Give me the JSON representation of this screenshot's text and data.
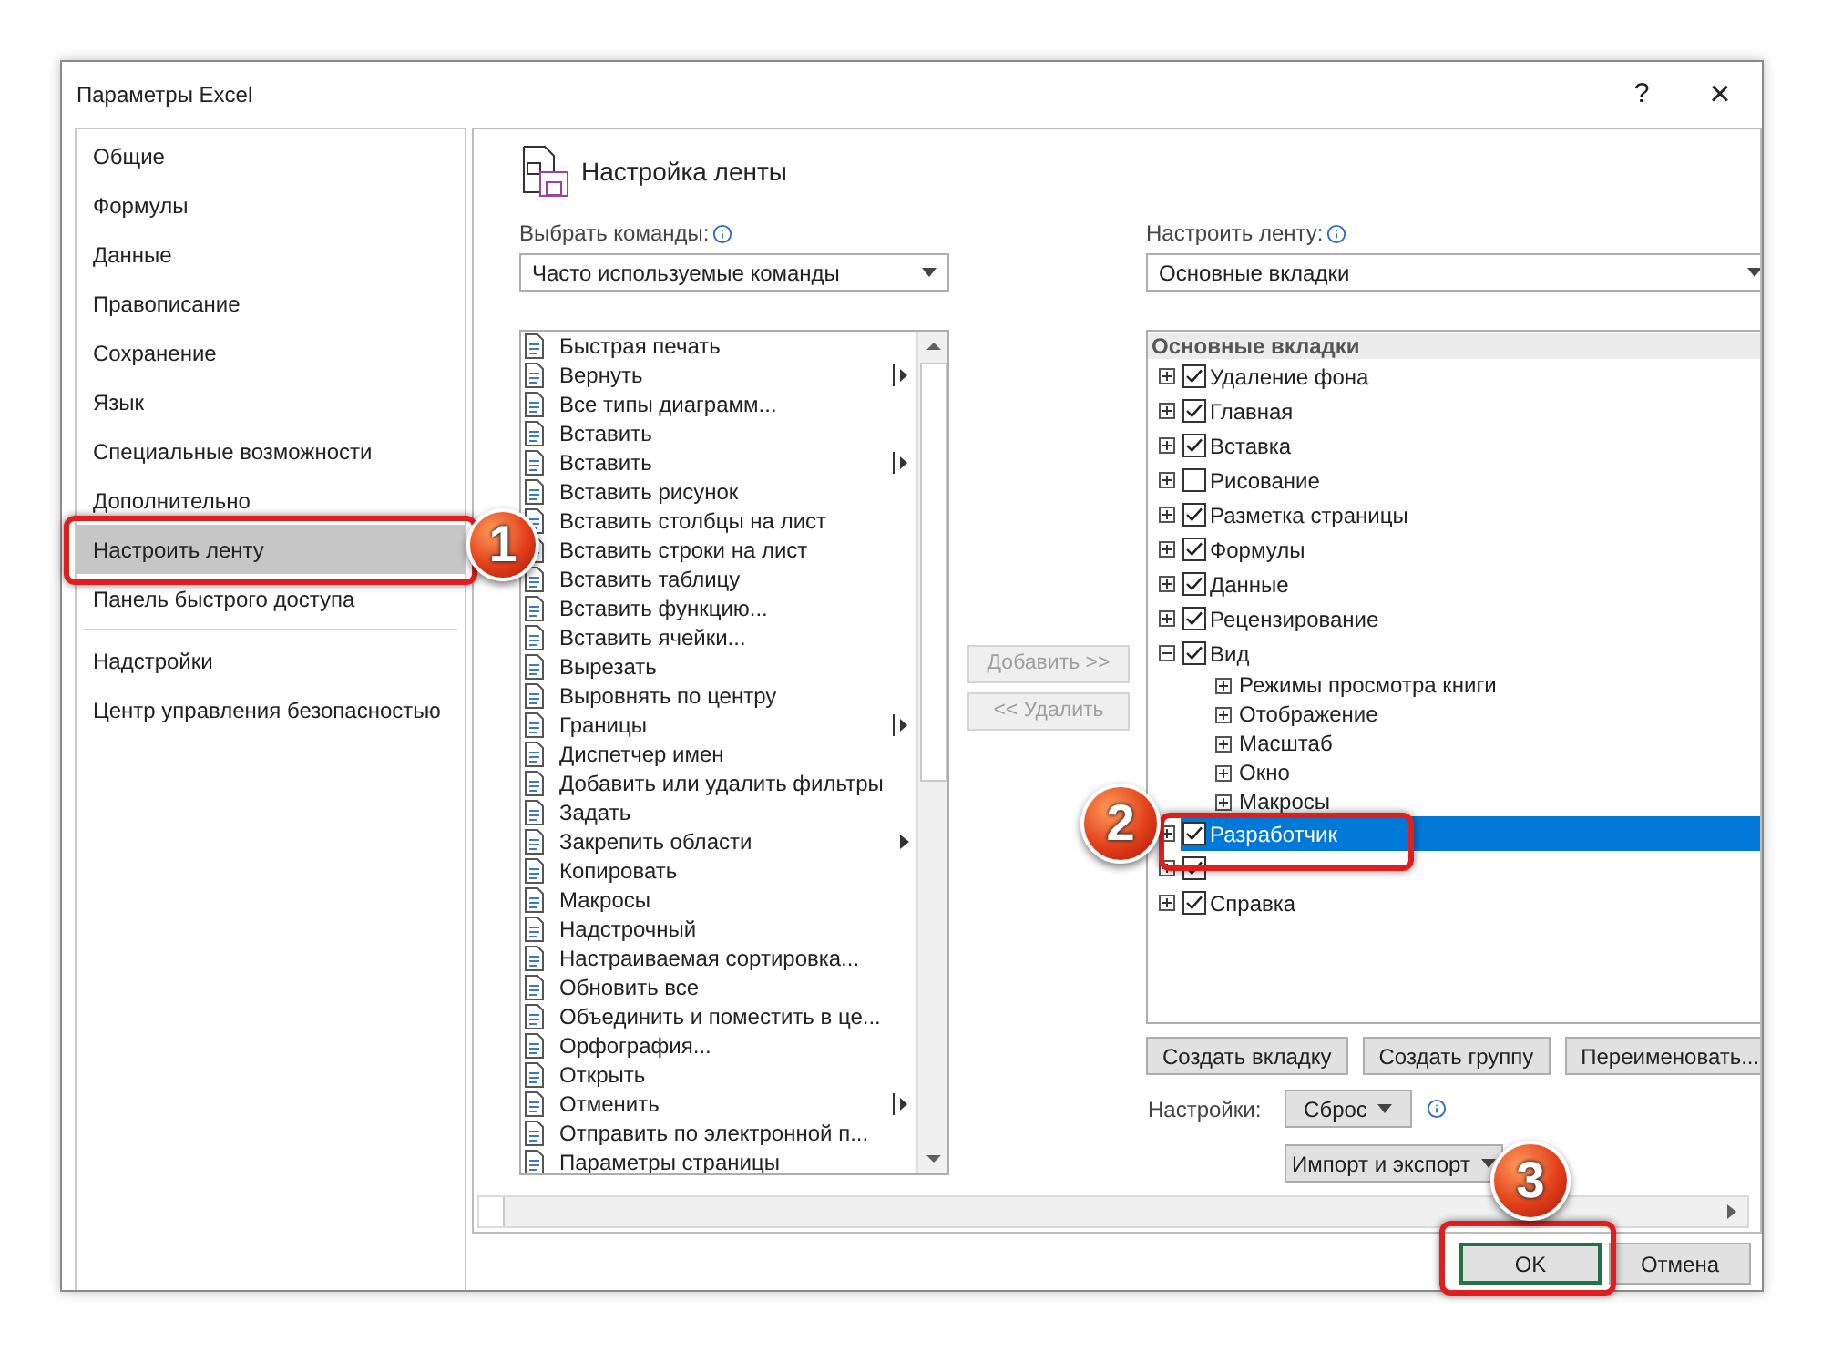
{
  "window": {
    "title": "Параметры Excel",
    "help": "?",
    "close": "×"
  },
  "sidebar": {
    "groups": [
      [
        {
          "label": "Общие",
          "selected": false
        },
        {
          "label": "Формулы",
          "selected": false
        },
        {
          "label": "Данные",
          "selected": false
        },
        {
          "label": "Правописание",
          "selected": false
        },
        {
          "label": "Сохранение",
          "selected": false
        },
        {
          "label": "Язык",
          "selected": false
        },
        {
          "label": "Специальные возможности",
          "selected": false
        },
        {
          "label": "Дополнительно",
          "selected": false
        },
        {
          "label": "Настроить ленту",
          "selected": true
        },
        {
          "label": "Панель быстрого доступа",
          "selected": false
        }
      ],
      [
        {
          "label": "Надстройки",
          "selected": false
        },
        {
          "label": "Центр управления безопасностью",
          "selected": false
        }
      ]
    ]
  },
  "main": {
    "heading": "Настройка ленты",
    "commands": {
      "label": "Выбрать команды:",
      "dropdown": "Часто используемые команды",
      "items": [
        {
          "label": "Быстрая печать",
          "kind": "plain"
        },
        {
          "label": "Вернуть",
          "kind": "split"
        },
        {
          "label": "Все типы диаграмм...",
          "kind": "plain"
        },
        {
          "label": "Вставить",
          "kind": "plain"
        },
        {
          "label": "Вставить",
          "kind": "split"
        },
        {
          "label": "Вставить рисунок",
          "kind": "plain"
        },
        {
          "label": "Вставить столбцы на лист",
          "kind": "plain"
        },
        {
          "label": "Вставить строки на лист",
          "kind": "plain"
        },
        {
          "label": "Вставить таблицу",
          "kind": "plain"
        },
        {
          "label": "Вставить функцию...",
          "kind": "plain"
        },
        {
          "label": "Вставить ячейки...",
          "kind": "plain"
        },
        {
          "label": "Вырезать",
          "kind": "plain"
        },
        {
          "label": "Выровнять по центру",
          "kind": "plain"
        },
        {
          "label": "Границы",
          "kind": "split"
        },
        {
          "label": "Диспетчер имен",
          "kind": "plain"
        },
        {
          "label": "Добавить или удалить фильтры",
          "kind": "plain"
        },
        {
          "label": "Задать",
          "kind": "plain"
        },
        {
          "label": "Закрепить области",
          "kind": "submenu"
        },
        {
          "label": "Копировать",
          "kind": "plain"
        },
        {
          "label": "Макросы",
          "kind": "plain"
        },
        {
          "label": "Надстрочный",
          "kind": "plain"
        },
        {
          "label": "Настраиваемая сортировка...",
          "kind": "plain"
        },
        {
          "label": "Обновить все",
          "kind": "plain"
        },
        {
          "label": "Объединить и поместить в це...",
          "kind": "plain"
        },
        {
          "label": "Орфография...",
          "kind": "plain"
        },
        {
          "label": "Открыть",
          "kind": "plain"
        },
        {
          "label": "Отменить",
          "kind": "split"
        },
        {
          "label": "Отправить по электронной п...",
          "kind": "plain"
        },
        {
          "label": "Параметры страницы",
          "kind": "plain"
        }
      ]
    },
    "transfer_buttons": [
      {
        "label": "Добавить >>",
        "disabled": true
      },
      {
        "label": "<< Удалить",
        "disabled": true
      }
    ],
    "ribbon": {
      "label": "Настроить ленту:",
      "dropdown": "Основные вкладки",
      "header": "Основные вкладки",
      "tabs": [
        {
          "label": "Удаление фона",
          "checked": true,
          "expanded": false,
          "selected": false
        },
        {
          "label": "Главная",
          "checked": true,
          "expanded": false,
          "selected": false
        },
        {
          "label": "Вставка",
          "checked": true,
          "expanded": false,
          "selected": false
        },
        {
          "label": "Рисование",
          "checked": false,
          "expanded": false,
          "selected": false
        },
        {
          "label": "Разметка страницы",
          "checked": true,
          "expanded": false,
          "selected": false
        },
        {
          "label": "Формулы",
          "checked": true,
          "expanded": false,
          "selected": false
        },
        {
          "label": "Данные",
          "checked": true,
          "expanded": false,
          "selected": false
        },
        {
          "label": "Рецензирование",
          "checked": true,
          "expanded": false,
          "selected": false
        },
        {
          "label": "Вид",
          "checked": true,
          "expanded": true,
          "selected": false,
          "children": [
            {
              "label": "Режимы просмотра книги",
              "expanded": false
            },
            {
              "label": "Отображение",
              "expanded": false
            },
            {
              "label": "Масштаб",
              "expanded": false
            },
            {
              "label": "Окно",
              "expanded": false
            },
            {
              "label": "Макросы",
              "expanded": false
            }
          ]
        },
        {
          "label": "Разработчик",
          "checked": true,
          "expanded": false,
          "selected": true
        },
        {
          "checked": true,
          "expanded": false,
          "selected": false
        },
        {
          "label": "Справка",
          "checked": true,
          "expanded": false,
          "selected": false
        }
      ]
    },
    "ribbon_buttons": [
      "Создать вкладку",
      "Создать группу",
      "Переименовать..."
    ],
    "settings": {
      "label": "Настройки:",
      "reset": "Сброс",
      "import_export": "Импорт и экспорт"
    }
  },
  "footer_buttons": [
    {
      "label": "OK",
      "default": true
    },
    {
      "label": "Отмена",
      "default": false
    }
  ],
  "annotations": [
    {
      "number": "1"
    },
    {
      "number": "2"
    },
    {
      "number": "3"
    }
  ]
}
